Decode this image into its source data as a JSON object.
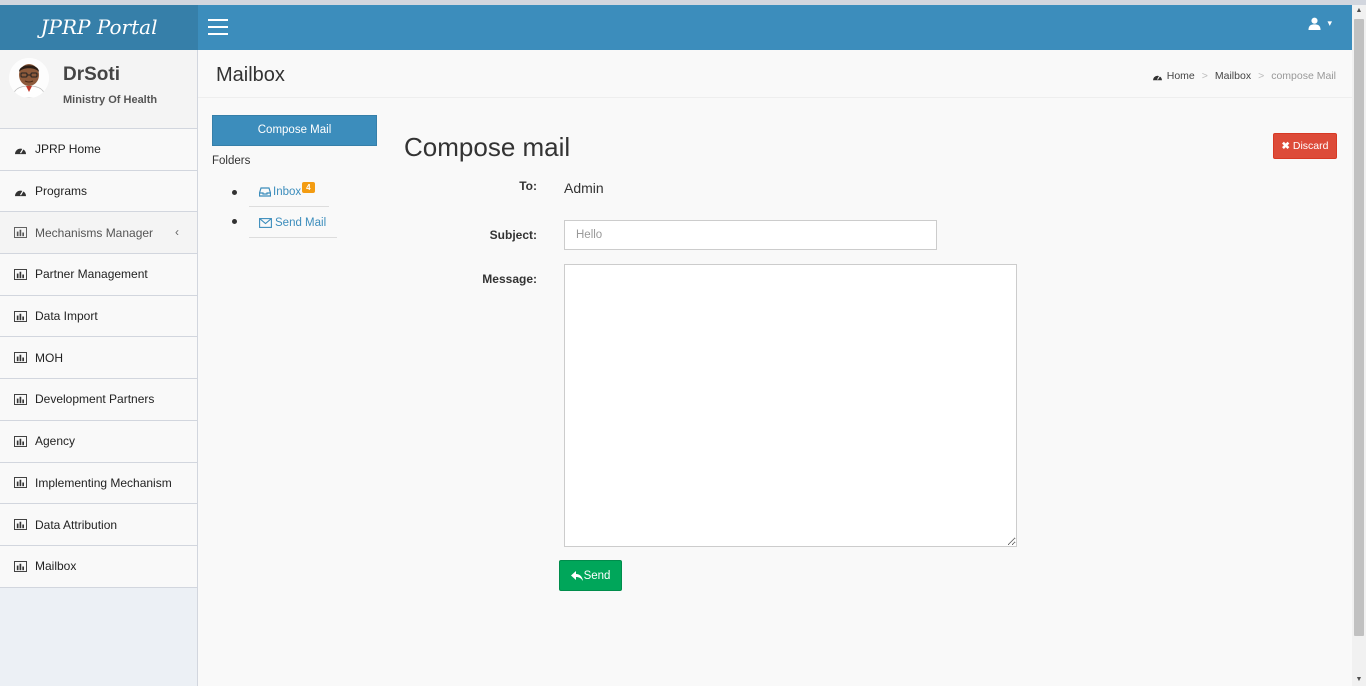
{
  "header": {
    "logo": "JPRP Portal",
    "user_menu_icon": "user-icon",
    "user_menu_caret": "▾"
  },
  "user_panel": {
    "name": "DrSoti",
    "organization": "Ministry Of Health"
  },
  "sidebar": {
    "items": [
      {
        "label": "JPRP Home",
        "icon": "dashboard-icon"
      },
      {
        "label": "Programs",
        "icon": "dashboard-icon"
      },
      {
        "label": "Mechanisms Manager",
        "icon": "bar-chart-icon",
        "chevron": "‹"
      },
      {
        "label": "Partner Management",
        "icon": "bar-chart-icon"
      },
      {
        "label": "Data Import",
        "icon": "bar-chart-icon"
      },
      {
        "label": "MOH",
        "icon": "bar-chart-icon"
      },
      {
        "label": "Development Partners",
        "icon": "bar-chart-icon"
      },
      {
        "label": "Agency",
        "icon": "bar-chart-icon"
      },
      {
        "label": "Implementing Mechanism",
        "icon": "bar-chart-icon"
      },
      {
        "label": "Data Attribution",
        "icon": "bar-chart-icon"
      },
      {
        "label": "Mailbox",
        "icon": "bar-chart-icon"
      }
    ]
  },
  "content_header": {
    "title": "Mailbox",
    "breadcrumb": {
      "home": "Home",
      "sep1": ">",
      "mailbox": "Mailbox",
      "sep2": ">",
      "current": "compose Mail"
    }
  },
  "mailbox": {
    "compose_button": "Compose Mail",
    "folders_title": "Folders",
    "folders": [
      {
        "label": "Inbox",
        "badge": "4",
        "icon": "inbox-icon"
      },
      {
        "label": "Send Mail",
        "icon": "envelope-icon"
      }
    ]
  },
  "compose": {
    "title": "Compose mail",
    "discard_button": "Discard",
    "to_label": "To:",
    "to_value": "Admin",
    "subject_label": "Subject:",
    "subject_placeholder": "Hello",
    "subject_value": "",
    "message_label": "Message:",
    "message_value": "",
    "send_button": "Send"
  },
  "colors": {
    "header": "#3c8dbc",
    "logo": "#367fa9",
    "primary": "#3c8dbc",
    "danger": "#dd4b39",
    "success": "#00a65a",
    "badge": "#f39c12"
  }
}
